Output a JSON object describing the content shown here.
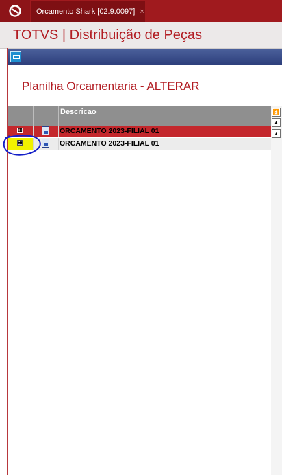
{
  "tab": {
    "title": "Orcamento Shark [02.9.0097]",
    "close": "×"
  },
  "app": {
    "title": "TOTVS | Distribuição de Peças"
  },
  "sheet": {
    "title": "Planilha Orcamentaria - ALTERAR"
  },
  "grid": {
    "columns": [
      "",
      "",
      "Descricao"
    ],
    "rows": [
      {
        "descricao": "ORCAMENTO 2023-FILIAL 01",
        "selected": true
      },
      {
        "descricao": "ORCAMENTO 2023-FILIAL 01",
        "selected": false,
        "highlighted": true
      }
    ],
    "expander_symbol": "⊞"
  },
  "scroll": {
    "top": "⏫",
    "up": "▲",
    "up_small": "▴"
  },
  "colors": {
    "tabbar": "#a01a1e",
    "title_red": "#b21c22",
    "selected_row": "#c4272c",
    "highlight_yellow": "#f2f200",
    "annotation_blue": "#1520c8",
    "header_gray": "#8f8f8f"
  },
  "icons": {
    "app": "totvs-logo-icon",
    "window": "window-icon",
    "row": "document-icon",
    "expand": "expand-icon"
  }
}
